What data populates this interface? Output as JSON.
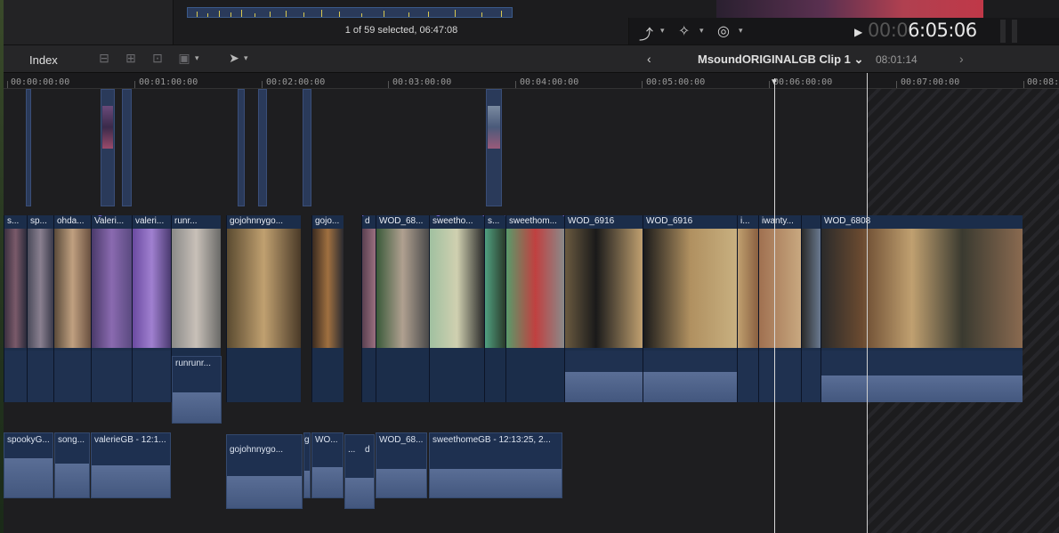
{
  "browser": {
    "selection_info": "1 of 59 selected, 06:47:08"
  },
  "viewer": {
    "timecode_dim": "00:0",
    "timecode_lit": "6:05:06",
    "play_icon": "play-icon"
  },
  "toolbar": {
    "index_label": "Index",
    "project_name": "MsoundORIGINALGB Clip 1",
    "project_chevron": "⌄",
    "project_duration": "08:01:14",
    "back_arrow": "‹",
    "forward_arrow": "›"
  },
  "ruler": {
    "labels": [
      "00:00:00:00",
      "00:01:00:00",
      "00:02:00:00",
      "00:03:00:00",
      "00:04:00:00",
      "00:05:00:00",
      "00:06:00:00",
      "00:07:00:00",
      "00:08:"
    ]
  },
  "primary_clips": [
    {
      "label": "s..."
    },
    {
      "label": "sp..."
    },
    {
      "label": "ohda..."
    },
    {
      "label": "Valeri..."
    },
    {
      "label": "valeri..."
    },
    {
      "label": "runr..."
    },
    {
      "label": "gojohnnygo..."
    },
    {
      "label": "gojo..."
    },
    {
      "label": "d"
    },
    {
      "label": "WOD_68..."
    },
    {
      "label": "sweetho..."
    },
    {
      "label": "s..."
    },
    {
      "label": "sweethom..."
    },
    {
      "label": "WOD_6916"
    },
    {
      "label": "WOD_6916"
    },
    {
      "label": "i..."
    },
    {
      "label": "iwanty..."
    },
    {
      "label": "WOD_6808"
    }
  ],
  "secondary_clips": [
    {
      "label": "runrunr..."
    },
    {
      "label": "spookyG..."
    },
    {
      "label": "song..."
    },
    {
      "label": "valerieGB - 12:1..."
    },
    {
      "label": "gojohnnygo..."
    },
    {
      "label": "g"
    },
    {
      "label": "WO..."
    },
    {
      "label": "..."
    },
    {
      "label": "d"
    },
    {
      "label": "WOD_68..."
    },
    {
      "label": "sweethomeGB - 12:13:25, 2..."
    }
  ]
}
